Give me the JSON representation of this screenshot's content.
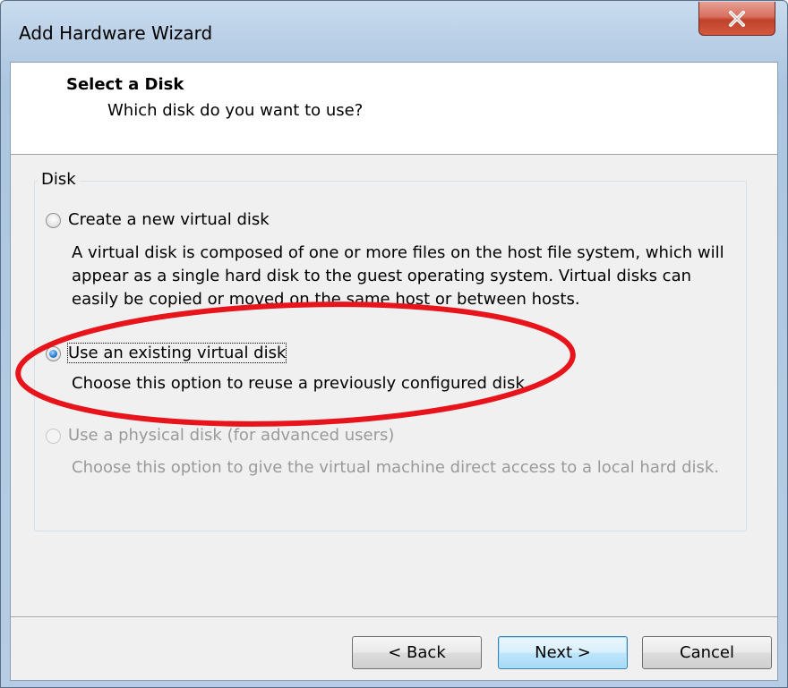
{
  "window": {
    "title": "Add Hardware Wizard",
    "close_glyph": "X"
  },
  "header": {
    "title": "Select a Disk",
    "subtitle": "Which disk do you want to use?"
  },
  "group": {
    "label": "Disk",
    "options": [
      {
        "label": "Create a new virtual disk",
        "description": "A virtual disk is composed of one or more files on the host file system, which will appear as a single hard disk to the guest operating system. Virtual disks can easily be copied or moved on the same host or between hosts.",
        "selected": false,
        "enabled": true
      },
      {
        "label": "Use an existing virtual disk",
        "description": "Choose this option to reuse a previously configured disk.",
        "selected": true,
        "enabled": true
      },
      {
        "label": "Use a physical disk (for advanced users)",
        "description": "Choose this option to give the virtual machine direct access to a local hard disk.",
        "selected": false,
        "enabled": false
      }
    ]
  },
  "buttons": {
    "back": "< Back",
    "next": "Next >",
    "cancel": "Cancel"
  },
  "annotation": {
    "color": "#e8141b",
    "shape": "ellipse"
  }
}
